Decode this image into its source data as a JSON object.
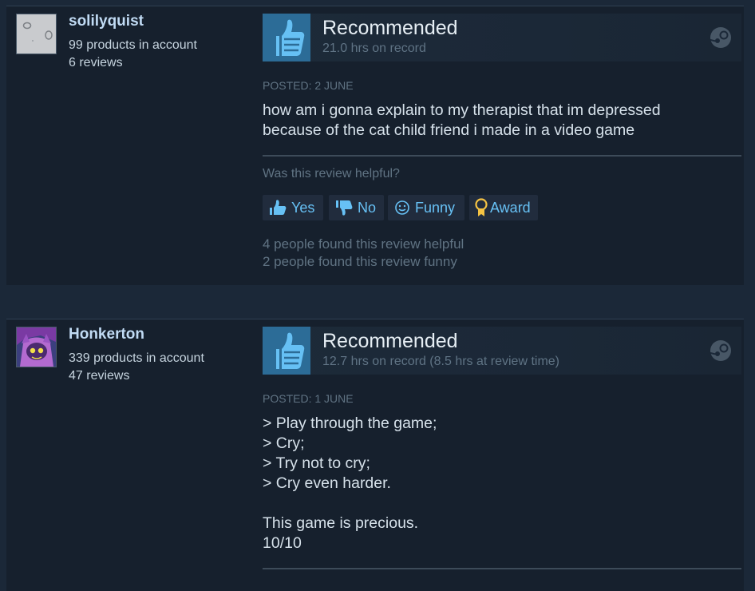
{
  "reviews": [
    {
      "author": {
        "name": "solilyquist",
        "products": "99 products in account",
        "reviews": "6 reviews"
      },
      "vote": {
        "title": "Recommended",
        "hours": "21.0 hrs on record"
      },
      "posted": "POSTED: 2 JUNE",
      "text": "how am i gonna explain to my therapist that im depressed\nbecause of the cat child friend i made in a video game",
      "helpful_question": "Was this review helpful?",
      "buttons": {
        "yes": "Yes",
        "no": "No",
        "funny": "Funny",
        "award": "Award"
      },
      "found_helpful": "4 people found this review helpful",
      "found_funny": "2 people found this review funny"
    },
    {
      "author": {
        "name": "Honkerton",
        "products": "339 products in account",
        "reviews": "47 reviews"
      },
      "vote": {
        "title": "Recommended",
        "hours": "12.7 hrs on record (8.5 hrs at review time)"
      },
      "posted": "POSTED: 1 JUNE",
      "text": "> Play through the game;\n> Cry;\n> Try not to cry;\n> Cry even harder.\n\nThis game is precious.\n10/10"
    }
  ],
  "colors": {
    "accent": "#67c1f5",
    "thumb_bg": "#2c6c97",
    "panel": "#16202d",
    "page": "#1b2838"
  },
  "icons": [
    "thumbs-up-icon",
    "steam-icon",
    "thumbs-down-icon",
    "smiley-icon",
    "award-icon"
  ]
}
